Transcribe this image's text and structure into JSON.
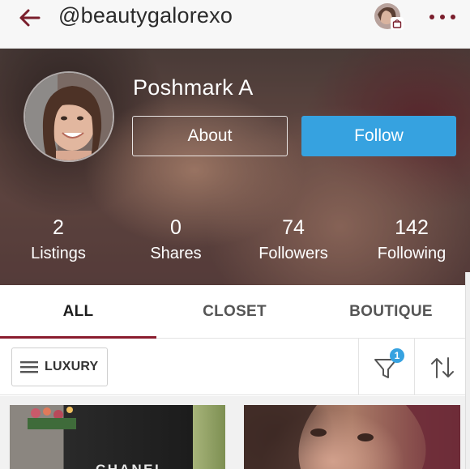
{
  "topbar": {
    "handle": "@beautygalorexo"
  },
  "profile": {
    "name": "Poshmark A",
    "about_label": "About",
    "follow_label": "Follow",
    "stats": [
      {
        "value": "2",
        "label": "Listings"
      },
      {
        "value": "0",
        "label": "Shares"
      },
      {
        "value": "74",
        "label": "Followers"
      },
      {
        "value": "142",
        "label": "Following"
      }
    ]
  },
  "tabs": [
    {
      "label": "ALL",
      "active": true
    },
    {
      "label": "CLOSET",
      "active": false
    },
    {
      "label": "BOUTIQUE",
      "active": false
    }
  ],
  "filters": {
    "luxury_label": "LUXURY",
    "filter_count": "1"
  },
  "listings": [
    {
      "visible_text": "CHANEL"
    },
    {
      "visible_text": ""
    }
  ],
  "colors": {
    "accent": "#7a1e2c",
    "follow_blue": "#36a2e0",
    "tab_underline": "#8a1c2e"
  },
  "icons": {
    "back": "arrow-left-icon",
    "more": "more-dots-icon",
    "bag": "shopping-bag-icon",
    "menu": "hamburger-icon",
    "filter": "funnel-icon",
    "sort": "sort-arrows-icon"
  }
}
